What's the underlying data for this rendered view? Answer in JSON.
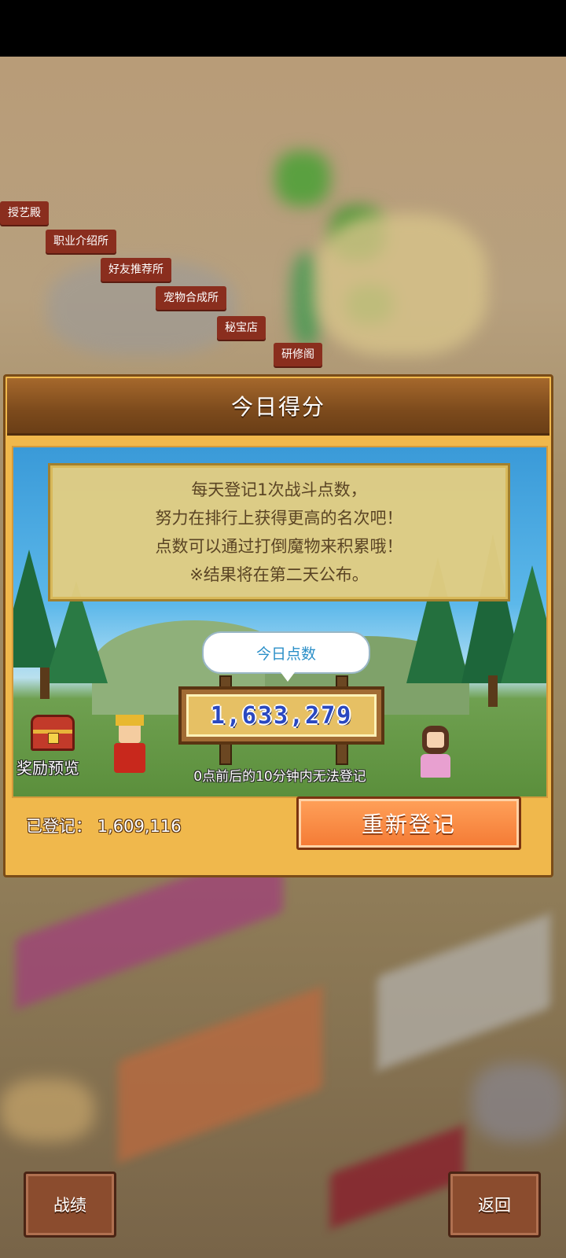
{
  "town": {
    "building_labels": [
      "授艺殿",
      "职业介绍所",
      "好友推荐所",
      "宠物合成所",
      "秘宝店",
      "研修阁"
    ]
  },
  "panel": {
    "title": "今日得分",
    "info_lines": [
      "每天登记1次战斗点数，",
      "努力在排行上获得更高的名次吧！",
      "点数可以通过打倒魔物来积累哦！",
      "※结果将在第二天公布。"
    ],
    "today_points_label": "今日点数",
    "today_points_value": "1,633,279",
    "reward_preview_label": "奖励预览",
    "notice": "0点前后的10分钟内无法登记",
    "registered_label": "已登记：",
    "registered_value": "1,609,116",
    "re_register_button": "重新登记"
  },
  "bottom": {
    "record_button": "战绩",
    "back_button": "返回"
  },
  "colors": {
    "panel_bg": "#f0b84c",
    "header_bg": "#7c4a1c",
    "button_orange": "#f47a34",
    "score_blue": "#2a48c0"
  }
}
